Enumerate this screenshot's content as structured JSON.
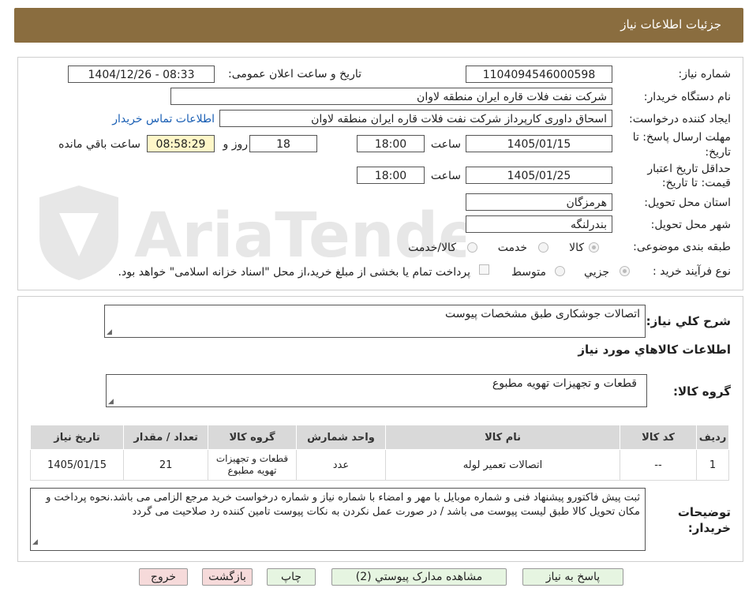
{
  "header": {
    "title": "جزئیات اطلاعات نیاز"
  },
  "form": {
    "need_number_label": "شماره نیاز:",
    "need_number": "1104094546000598",
    "announce_label": "تاریخ و ساعت اعلان عمومی:",
    "announce_value": "1404/12/26 - 08:33",
    "buyer_org_label": "نام دستگاه خریدار:",
    "buyer_org": "شرکت نفت فلات قاره ایران منطقه لاوان",
    "creator_label": "ایجاد کننده درخواست:",
    "creator": "اسحاق داوری کارپرداز شرکت نفت فلات قاره ایران منطقه لاوان",
    "contact_link": "اطلاعات تماس خریدار",
    "deadline_label_1": "مهلت ارسال پاسخ: تا",
    "deadline_label_2": "تاریخ:",
    "deadline_date": "1405/01/15",
    "time_label": "ساعت",
    "deadline_time": "18:00",
    "days_value": "18",
    "days_label": "روز و",
    "remaining_time": "08:58:29",
    "remaining_label": "ساعت باقي مانده",
    "validity_label_1": "حداقل تاریخ اعتبار",
    "validity_label_2": "قیمت: تا تاریخ:",
    "validity_date": "1405/01/25",
    "validity_time": "18:00",
    "province_label": "استان محل تحویل:",
    "province": "هرمزگان",
    "city_label": "شهر محل تحویل:",
    "city": "بندرلنگه",
    "category_label": "طبقه بندی موضوعی:",
    "category_options": [
      "کالا",
      "خدمت",
      "کالا/خدمت"
    ],
    "process_label": "نوع فرآیند خرید :",
    "process_options": [
      "جزیي",
      "متوسط"
    ],
    "payment_note": "پرداخت تمام یا بخشی از مبلغ خرید،از محل \"اسناد خزانه اسلامی\" خواهد بود."
  },
  "summary": {
    "description_label": "شرح کلي نیاز:",
    "description": "اتصالات  جوشکاری طبق مشخصات پیوست",
    "goods_info_title": "اطلاعات کالاهاي مورد نياز",
    "goods_group_label": "گروه کالا:",
    "goods_group": "قطعات و تجهیزات تهویه مطبوع"
  },
  "table": {
    "headers": [
      "رديف",
      "کد کالا",
      "نام کالا",
      "واحد شمارش",
      "گروه کالا",
      "تعداد / مقدار",
      "تاریخ نیاز"
    ],
    "rows": [
      [
        "1",
        "--",
        "اتصالات تعمیر لوله",
        "عدد",
        "قطعات و تجهیزات تهویه مطبوع",
        "21",
        "1405/01/15"
      ]
    ]
  },
  "notes": {
    "label_1": "توضیحات",
    "label_2": "خریدار:",
    "text": "ثبت پیش فاکتورو پیشنهاد فنی و شماره موبایل با مهر و امضاء با شماره نیاز و شماره درخواست خرید مرجع الزامی می باشد.نحوه پرداخت و مکان تحویل کالا طبق لیست پیوست می باشد / در صورت عمل نکردن به نکات پیوست تامین کننده رد صلاحیت می گردد"
  },
  "buttons": {
    "reply": "پاسخ به نیاز",
    "attachments": "مشاهده مدارک پیوستي (2)",
    "print": "چاپ",
    "back": "بازگشت",
    "exit": "خروج"
  },
  "watermark": {
    "text": "AriaTender.net"
  },
  "colors": {
    "header": "#8a6d3f",
    "link": "#1a5fb4",
    "green_button": "#e6f5e1",
    "pink_button": "#f6dada"
  }
}
